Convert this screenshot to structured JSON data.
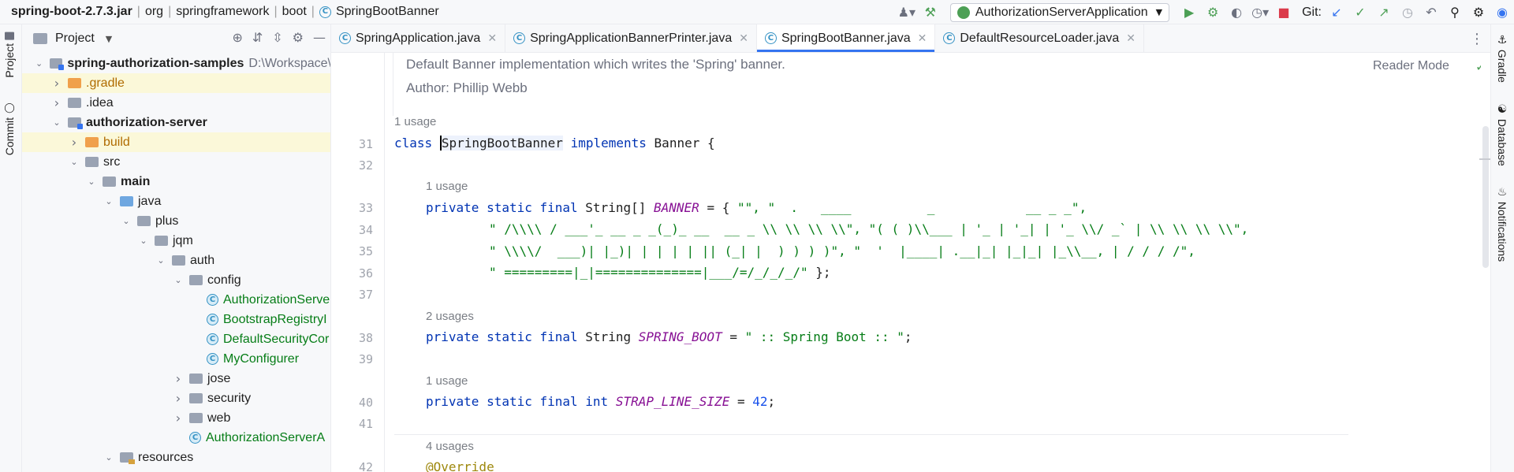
{
  "breadcrumb": {
    "items": [
      "spring-boot-2.7.3.jar",
      "org",
      "springframework",
      "boot",
      "SpringBootBanner"
    ]
  },
  "toolbar": {
    "run_config": "AuthorizationServerApplication",
    "git_label": "Git:"
  },
  "left_strip": {
    "project_tab": "Project",
    "commit_tab": "Commit"
  },
  "project_panel": {
    "title": "Project",
    "tree": [
      {
        "label": "spring-authorization-samples",
        "sub": "D:\\Workspace\\",
        "type": "module-root",
        "depth": 0,
        "arrow": "down"
      },
      {
        "label": ".gradle",
        "type": "folder-orange",
        "depth": 1,
        "arrow": "right",
        "highlight": true
      },
      {
        "label": ".idea",
        "type": "folder",
        "depth": 1,
        "arrow": "right"
      },
      {
        "label": "authorization-server",
        "type": "module",
        "depth": 1,
        "arrow": "down"
      },
      {
        "label": "build",
        "type": "folder-orange",
        "depth": 2,
        "arrow": "right",
        "highlight": true
      },
      {
        "label": "src",
        "type": "folder",
        "depth": 2,
        "arrow": "down"
      },
      {
        "label": "main",
        "type": "folder",
        "depth": 3,
        "arrow": "down"
      },
      {
        "label": "java",
        "type": "folder-blue",
        "depth": 4,
        "arrow": "down"
      },
      {
        "label": "plus",
        "type": "package",
        "depth": 5,
        "arrow": "down"
      },
      {
        "label": "jqm",
        "type": "package",
        "depth": 6,
        "arrow": "down"
      },
      {
        "label": "auth",
        "type": "package",
        "depth": 7,
        "arrow": "down"
      },
      {
        "label": "config",
        "type": "package",
        "depth": 8,
        "arrow": "down"
      },
      {
        "label": "AuthorizationServe",
        "type": "class",
        "depth": 9
      },
      {
        "label": "BootstrapRegistryI",
        "type": "class",
        "depth": 9
      },
      {
        "label": "DefaultSecurityCor",
        "type": "class",
        "depth": 9
      },
      {
        "label": "MyConfigurer",
        "type": "class",
        "depth": 9
      },
      {
        "label": "jose",
        "type": "package",
        "depth": 8,
        "arrow": "right"
      },
      {
        "label": "security",
        "type": "package",
        "depth": 8,
        "arrow": "right"
      },
      {
        "label": "web",
        "type": "package",
        "depth": 8,
        "arrow": "right"
      },
      {
        "label": "AuthorizationServerA",
        "type": "class-app",
        "depth": 8
      },
      {
        "label": "resources",
        "type": "folder-res",
        "depth": 4,
        "arrow": "down"
      }
    ]
  },
  "editor_tabs": [
    {
      "label": "SpringApplication.java",
      "active": false
    },
    {
      "label": "SpringApplicationBannerPrinter.java",
      "active": false
    },
    {
      "label": "SpringBootBanner.java",
      "active": true
    },
    {
      "label": "DefaultResourceLoader.java",
      "active": false
    }
  ],
  "editor": {
    "doc_line1": "Default Banner implementation which writes the 'Spring' banner.",
    "doc_line2": "Author: Phillip Webb",
    "reader_mode": "Reader Mode",
    "usage_1": "1 usage",
    "usage_2": "1 usage",
    "usage_3": "2 usages",
    "usage_4": "1 usage",
    "usage_5": "4 usages",
    "line_numbers": [
      "31",
      "32",
      "33",
      "34",
      "35",
      "36",
      "37",
      "38",
      "39",
      "40",
      "41",
      "42"
    ],
    "l31_kw": "class",
    "l31_cls": "SpringBootBanner",
    "l31_kw2": "implements",
    "l31_rest": "Banner {",
    "l33_kw": "private static final",
    "l33_type": "String[]",
    "l33_fld": "BANNER",
    "l33_eq": "= { ",
    "l33_str": "\"\", \"  .   ____          _            __ _ _\",",
    "l34_str": "\" /\\\\\\\\ / ___'_ __ _ _(_)_ __  __ _ \\\\ \\\\ \\\\ \\\\\", \"( ( )\\\\___ | '_ | '_| | '_ \\\\/ _` | \\\\ \\\\ \\\\ \\\\\",",
    "l35_str": "\" \\\\\\\\/  ___)| |_)| | | | | || (_| |  ) ) ) )\", \"  '  |____| .__|_| |_|_| |_\\\\__, | / / / /\",",
    "l36_str": "\" =========|_|==============|___/=/_/_/_/\"",
    "l36_end": " };",
    "l38_kw": "private static final",
    "l38_type": "String",
    "l38_fld": "SPRING_BOOT",
    "l38_eq": "= ",
    "l38_str": "\" :: Spring Boot :: \"",
    "l38_end": ";",
    "l40_kw": "private static final int",
    "l40_fld": "STRAP_LINE_SIZE",
    "l40_eq": "= ",
    "l40_num": "42",
    "l40_end": ";",
    "l42_ann": "@Override"
  },
  "right_strip": {
    "gradle": "Gradle",
    "database": "Database",
    "notifications": "Notifications"
  },
  "colors": {
    "keyword": "#0033b3",
    "string": "#067d17",
    "field": "#871094",
    "number": "#1750eb",
    "annotation": "#9e880d",
    "accent": "#3574f0"
  }
}
